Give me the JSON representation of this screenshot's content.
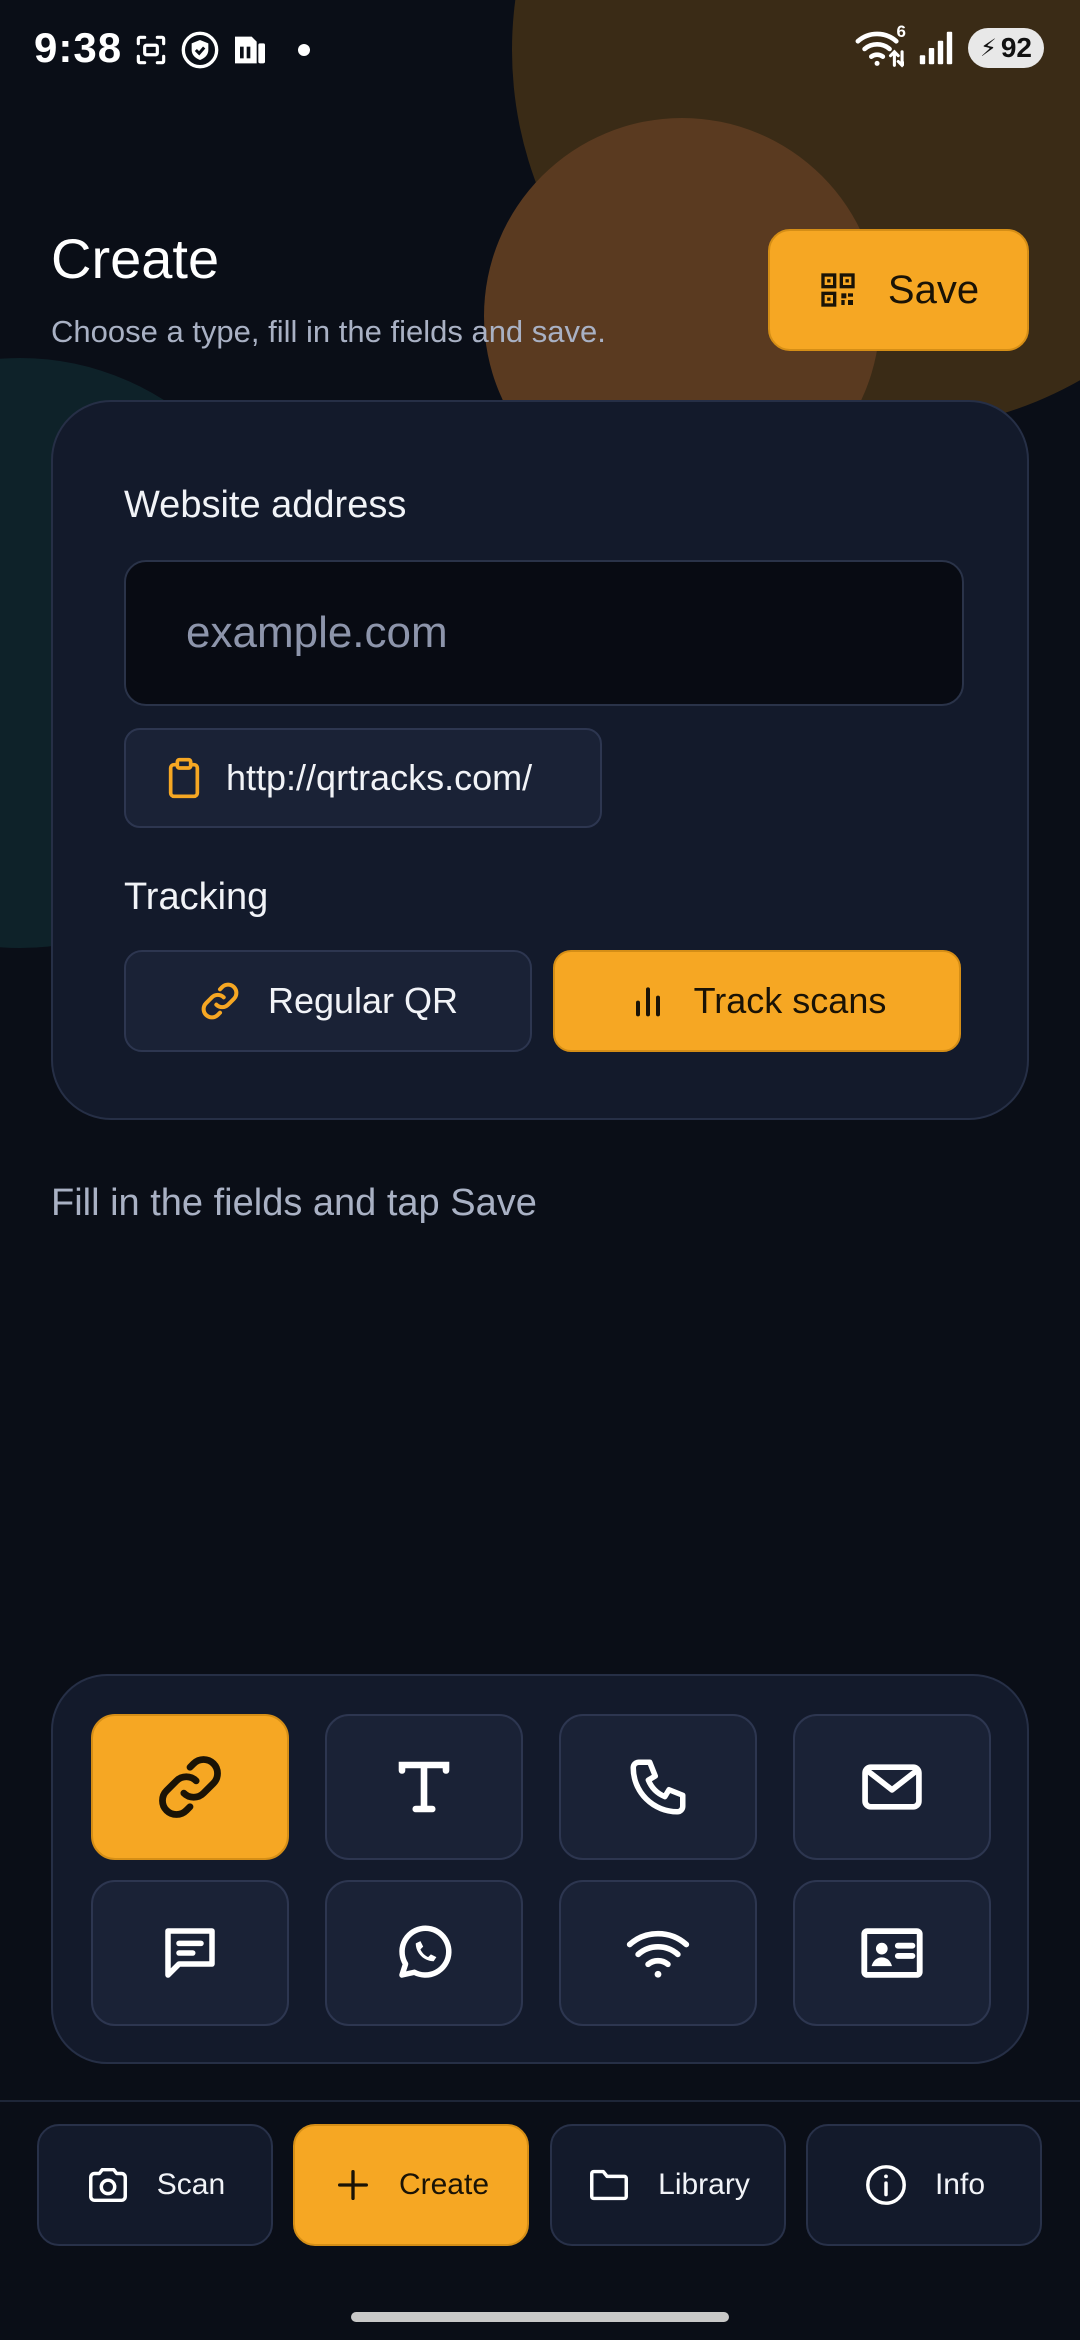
{
  "status_bar": {
    "time": "9:38",
    "battery": "92",
    "wifi_badge": "6",
    "left_icons": [
      "screen-capture-icon",
      "shield-check-icon",
      "sim-card-icon",
      "notification-dot-icon"
    ],
    "right_icons": [
      "wifi-icon",
      "signal-icon",
      "battery-icon"
    ]
  },
  "header": {
    "title": "Create",
    "subtitle": "Choose a type, fill in the fields and save.",
    "save_label": "Save",
    "save_icon": "qr-code-icon"
  },
  "form": {
    "website_label": "Website address",
    "url_value": "",
    "url_placeholder": "example.com",
    "paste_suggestion": "http://qrtracks.com/",
    "paste_icon": "clipboard-icon",
    "tracking_label": "Tracking",
    "tracking_options": [
      {
        "label": "Regular QR",
        "icon": "link-icon",
        "selected": false
      },
      {
        "label": "Track scans",
        "icon": "bar-chart-icon",
        "selected": true
      }
    ]
  },
  "helper_text": "Fill in the fields and tap Save",
  "types": [
    {
      "name": "url",
      "icon": "link-icon",
      "selected": true
    },
    {
      "name": "text",
      "icon": "text-icon",
      "selected": false
    },
    {
      "name": "phone",
      "icon": "phone-icon",
      "selected": false
    },
    {
      "name": "email",
      "icon": "mail-icon",
      "selected": false
    },
    {
      "name": "sms",
      "icon": "message-icon",
      "selected": false
    },
    {
      "name": "whatsapp",
      "icon": "whatsapp-icon",
      "selected": false
    },
    {
      "name": "wifi",
      "icon": "wifi-icon",
      "selected": false
    },
    {
      "name": "contact",
      "icon": "contact-card-icon",
      "selected": false
    }
  ],
  "nav": [
    {
      "label": "Scan",
      "icon": "camera-icon",
      "active": false
    },
    {
      "label": "Create",
      "icon": "plus-icon",
      "active": true
    },
    {
      "label": "Library",
      "icon": "folder-icon",
      "active": false
    },
    {
      "label": "Info",
      "icon": "info-icon",
      "active": false
    }
  ],
  "colors": {
    "background": "#0a0e17",
    "card": "#131a2b",
    "tile": "#1a2236",
    "accent": "#f6a723",
    "text_primary": "#f1f3f7",
    "text_secondary": "#a9b1c4"
  }
}
